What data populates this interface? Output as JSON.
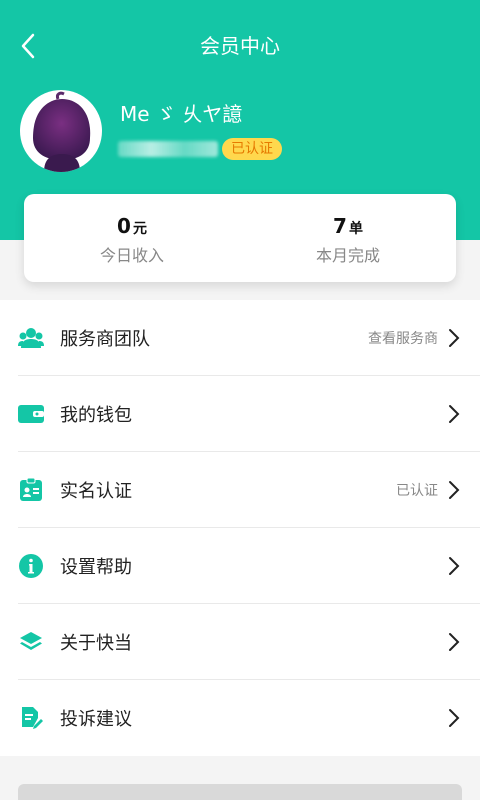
{
  "header": {
    "title": "会员中心"
  },
  "profile": {
    "name": "Me ゞ 乆ヤ譩",
    "verified_label": "已认证"
  },
  "stats": [
    {
      "value": "0",
      "unit": "元",
      "label": "今日收入"
    },
    {
      "value": "7",
      "unit": "单",
      "label": "本月完成"
    }
  ],
  "menu": [
    {
      "label": "服务商团队",
      "extra": "查看服务商",
      "icon": "team-icon"
    },
    {
      "label": "我的钱包",
      "extra": "",
      "icon": "wallet-icon"
    },
    {
      "label": "实名认证",
      "extra": "已认证",
      "icon": "id-card-icon"
    },
    {
      "label": "设置帮助",
      "extra": "",
      "icon": "info-icon"
    },
    {
      "label": "关于快当",
      "extra": "",
      "icon": "layers-icon"
    },
    {
      "label": "投诉建议",
      "extra": "",
      "icon": "feedback-icon"
    }
  ],
  "colors": {
    "primary": "#14c6a6",
    "badge_bg": "#ffd84d",
    "badge_text": "#e67a00"
  }
}
